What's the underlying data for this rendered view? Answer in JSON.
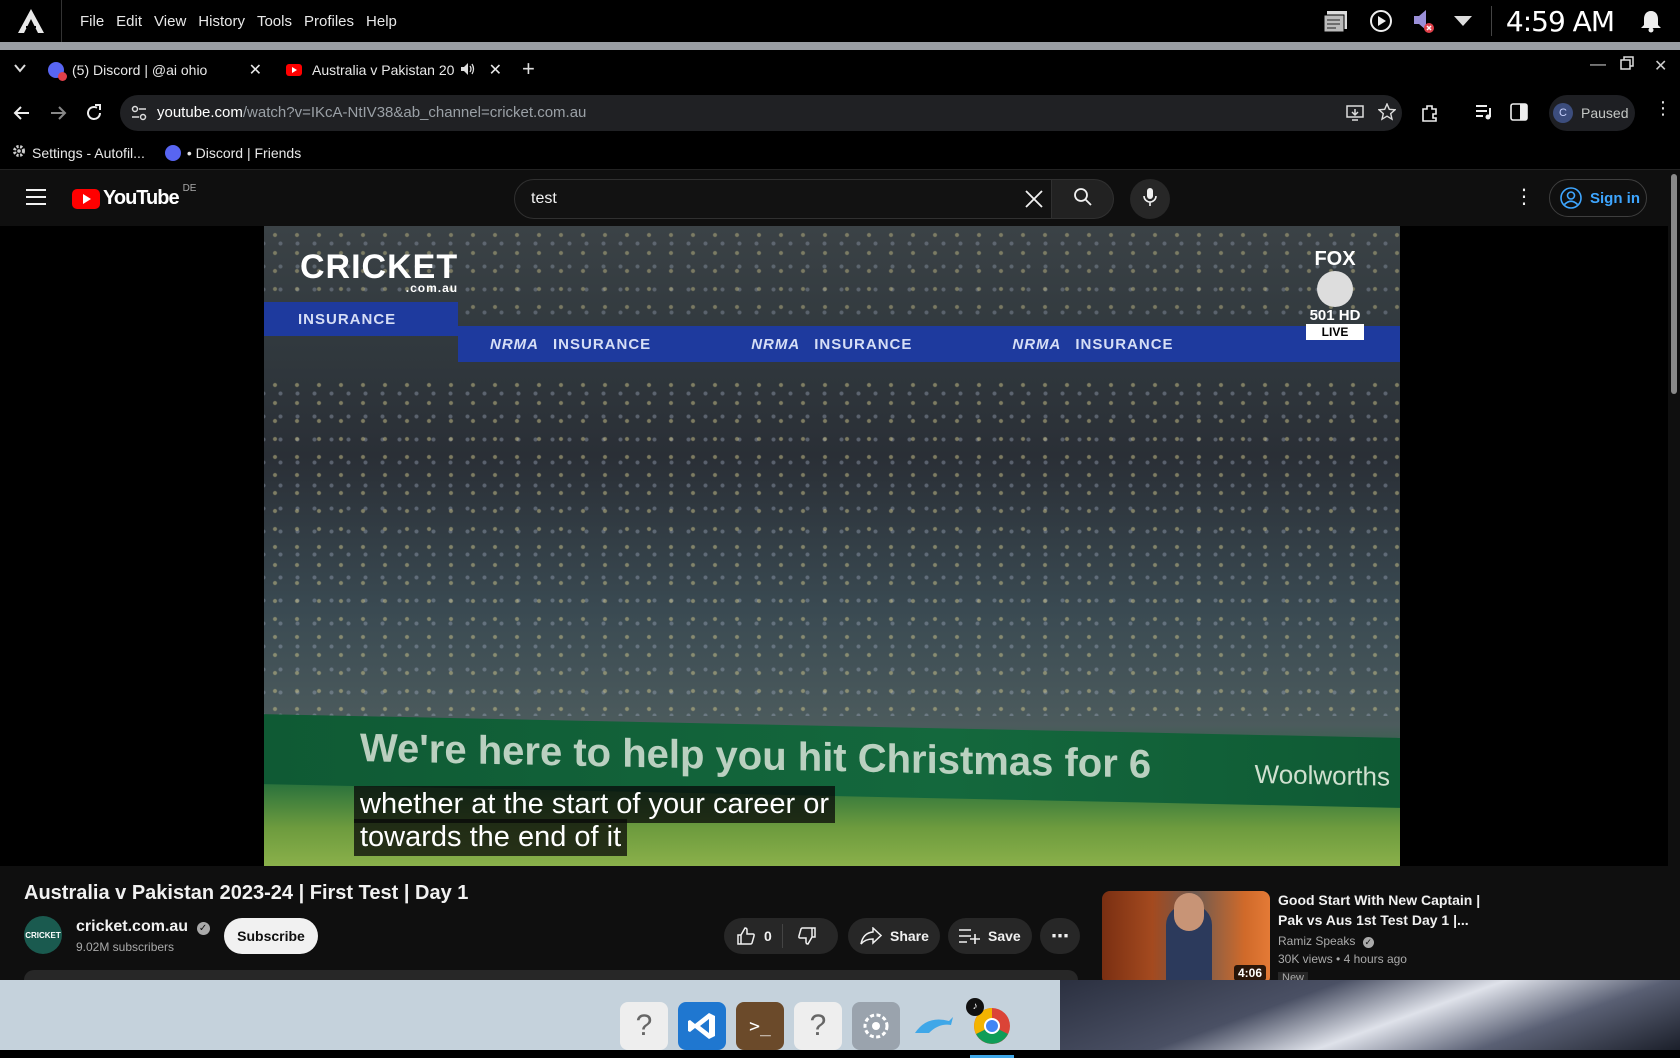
{
  "system_menu": {
    "items": [
      "File",
      "Edit",
      "View",
      "History",
      "Tools",
      "Profiles",
      "Help"
    ],
    "clock": "4:59 AM"
  },
  "tabs": [
    {
      "label": "(5) Discord | @ai ohio"
    },
    {
      "label": "Australia v Pakistan 20"
    }
  ],
  "address_bar": {
    "domain": "youtube.com",
    "path": "/watch?v=IKcA-NtIV38&ab_channel=cricket.com.au",
    "profile_initial": "C",
    "profile_status": "Paused"
  },
  "bookmarks": [
    {
      "label": "Settings - Autofil..."
    },
    {
      "label": "• Discord | Friends"
    }
  ],
  "youtube": {
    "logo_text": "YouTube",
    "region": "DE",
    "search_value": "test",
    "sign_in": "Sign in"
  },
  "video": {
    "caption_line1": "whether at the start of your career or",
    "caption_line2": "towards the end of it",
    "overlay_left_logo": "CRICKET",
    "overlay_left_sub": ".com.au",
    "overlay_right_top": "FOX",
    "overlay_right_mid": "501 HD",
    "overlay_right_bottom": "LIVE",
    "banner_insurance": "INSURANCE",
    "banner_nrma": "NRMA",
    "adboard_text": "We're here to help you hit Christmas for 6",
    "adboard_brand": "Woolworths"
  },
  "video_info": {
    "title": "Australia v Pakistan 2023-24 | First Test | Day 1",
    "channel": "cricket.com.au",
    "channel_avatar_text": "CRICKET",
    "subscribers": "9.02M subscribers",
    "subscribe": "Subscribe",
    "likes": "0",
    "share": "Share",
    "save": "Save"
  },
  "recommendation": {
    "title": "Good Start With New Captain | Pak vs Aus 1st Test Day 1 |...",
    "channel": "Ramiz Speaks",
    "views": "30K views",
    "age": "4 hours ago",
    "duration": "4:06",
    "badge": "New"
  },
  "colors": {
    "yt_red": "#ff0000",
    "link_blue": "#3ea6ff",
    "bg": "#0f0f0f"
  }
}
